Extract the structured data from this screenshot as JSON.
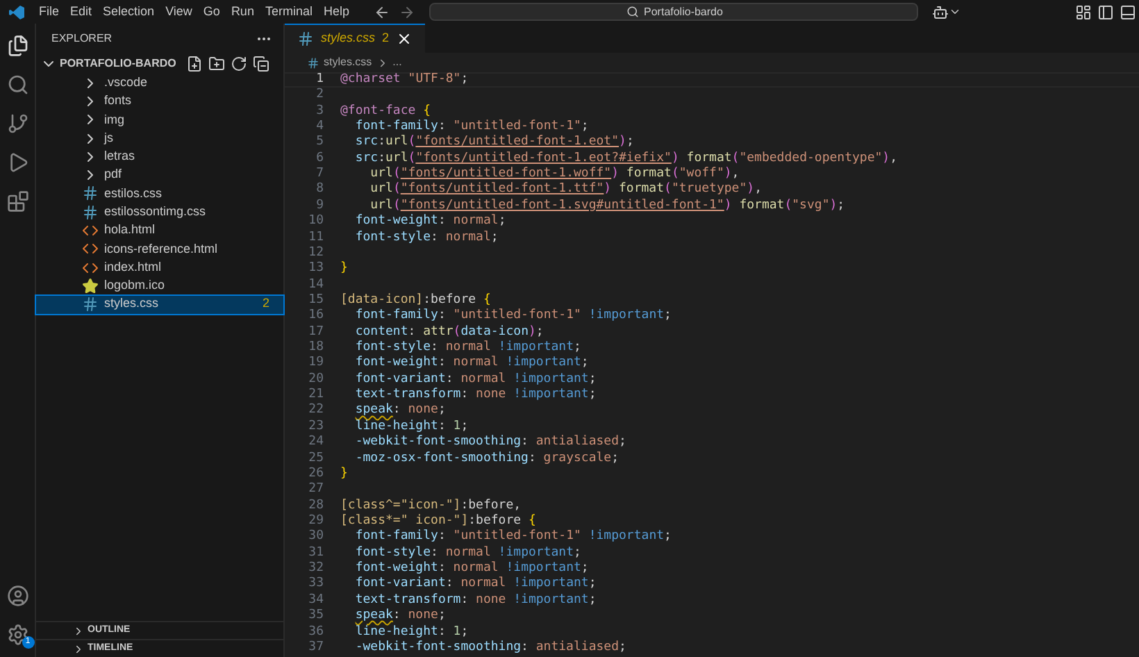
{
  "menu": [
    "File",
    "Edit",
    "Selection",
    "View",
    "Go",
    "Run",
    "Terminal",
    "Help"
  ],
  "command_center": {
    "text": "Portafolio-bardo"
  },
  "sidebar": {
    "title": "EXPLORER",
    "folder": "PORTAFOLIO-BARDO",
    "expanded": true,
    "items": [
      {
        "kind": "folder",
        "name": ".vscode",
        "selected": false
      },
      {
        "kind": "folder",
        "name": "fonts",
        "selected": false
      },
      {
        "kind": "folder",
        "name": "img",
        "selected": false
      },
      {
        "kind": "folder",
        "name": "js",
        "selected": false
      },
      {
        "kind": "folder",
        "name": "letras",
        "selected": false
      },
      {
        "kind": "folder",
        "name": "pdf",
        "selected": false
      },
      {
        "kind": "css",
        "name": "estilos.css",
        "selected": false
      },
      {
        "kind": "css",
        "name": "estilossontimg.css",
        "selected": false
      },
      {
        "kind": "html",
        "name": "hola.html",
        "selected": false
      },
      {
        "kind": "html",
        "name": "icons-reference.html",
        "selected": false
      },
      {
        "kind": "html",
        "name": "index.html",
        "selected": false
      },
      {
        "kind": "ico",
        "name": "logobm.ico",
        "selected": false
      },
      {
        "kind": "css",
        "name": "styles.css",
        "selected": true,
        "badge": "2"
      }
    ],
    "sections": [
      "OUTLINE",
      "TIMELINE"
    ]
  },
  "settings_badge": "1",
  "tab": {
    "name": "styles.css",
    "problems": "2",
    "selected": true
  },
  "breadcrumb": [
    "styles.css",
    "..."
  ],
  "editor": {
    "lines": [
      {
        "number": "1",
        "current": true,
        "tokens": [
          {
            "kind": "at",
            "text": "@charset"
          },
          {
            "kind": "str",
            "text": " \"UTF-8\""
          },
          {
            "kind": "plain",
            "text": ";"
          }
        ]
      },
      {
        "number": "2",
        "current": false
      },
      {
        "number": "3",
        "current": false,
        "tokens": [
          {
            "kind": "at",
            "text": "@font-face"
          },
          {
            "kind": "brace",
            "text": " {"
          }
        ]
      },
      {
        "number": "4",
        "current": false,
        "tokens": [
          {
            "kind": "prop",
            "text": "  font-family"
          },
          {
            "kind": "plain",
            "text": ":"
          },
          {
            "kind": "str",
            "text": " \"untitled-font-1\""
          },
          {
            "kind": "plain",
            "text": ";"
          }
        ]
      },
      {
        "number": "5",
        "current": false,
        "tokens": [
          {
            "kind": "prop",
            "text": "  src"
          },
          {
            "kind": "plain",
            "text": ":"
          },
          {
            "kind": "fn",
            "text": "url"
          },
          {
            "kind": "paren",
            "text": "("
          },
          {
            "kind": "link",
            "text": "\"fonts/untitled-font-1.eot\""
          },
          {
            "kind": "paren",
            "text": ")"
          },
          {
            "kind": "plain",
            "text": ";"
          }
        ]
      },
      {
        "number": "6",
        "current": false,
        "tokens": [
          {
            "kind": "prop",
            "text": "  src"
          },
          {
            "kind": "plain",
            "text": ":"
          },
          {
            "kind": "fn",
            "text": "url"
          },
          {
            "kind": "paren",
            "text": "("
          },
          {
            "kind": "link",
            "text": "\"fonts/untitled-font-1.eot?#iefix\""
          },
          {
            "kind": "paren",
            "text": ")"
          },
          {
            "kind": "fn",
            "text": " format"
          },
          {
            "kind": "paren",
            "text": "("
          },
          {
            "kind": "str",
            "text": "\"embedded-opentype\""
          },
          {
            "kind": "paren",
            "text": ")"
          },
          {
            "kind": "plain",
            "text": ","
          }
        ]
      },
      {
        "number": "7",
        "current": false,
        "tokens": [
          {
            "kind": "fn",
            "text": "    url"
          },
          {
            "kind": "paren",
            "text": "("
          },
          {
            "kind": "link",
            "text": "\"fonts/untitled-font-1.woff\""
          },
          {
            "kind": "paren",
            "text": ")"
          },
          {
            "kind": "fn",
            "text": " format"
          },
          {
            "kind": "paren",
            "text": "("
          },
          {
            "kind": "str",
            "text": "\"woff\""
          },
          {
            "kind": "paren",
            "text": ")"
          },
          {
            "kind": "plain",
            "text": ","
          }
        ]
      },
      {
        "number": "8",
        "current": false,
        "tokens": [
          {
            "kind": "fn",
            "text": "    url"
          },
          {
            "kind": "paren",
            "text": "("
          },
          {
            "kind": "link",
            "text": "\"fonts/untitled-font-1.ttf\""
          },
          {
            "kind": "paren",
            "text": ")"
          },
          {
            "kind": "fn",
            "text": " format"
          },
          {
            "kind": "paren",
            "text": "("
          },
          {
            "kind": "str",
            "text": "\"truetype\""
          },
          {
            "kind": "paren",
            "text": ")"
          },
          {
            "kind": "plain",
            "text": ","
          }
        ]
      },
      {
        "number": "9",
        "current": false,
        "tokens": [
          {
            "kind": "fn",
            "text": "    url"
          },
          {
            "kind": "paren",
            "text": "("
          },
          {
            "kind": "link",
            "text": "\"fonts/untitled-font-1.svg#untitled-font-1\""
          },
          {
            "kind": "paren",
            "text": ")"
          },
          {
            "kind": "fn",
            "text": " format"
          },
          {
            "kind": "paren",
            "text": "("
          },
          {
            "kind": "str",
            "text": "\"svg\""
          },
          {
            "kind": "paren",
            "text": ")"
          },
          {
            "kind": "plain",
            "text": ";"
          }
        ]
      },
      {
        "number": "10",
        "current": false,
        "tokens": [
          {
            "kind": "prop",
            "text": "  font-weight"
          },
          {
            "kind": "plain",
            "text": ":"
          },
          {
            "kind": "str",
            "text": " normal"
          },
          {
            "kind": "plain",
            "text": ";"
          }
        ]
      },
      {
        "number": "11",
        "current": false,
        "tokens": [
          {
            "kind": "prop",
            "text": "  font-style"
          },
          {
            "kind": "plain",
            "text": ":"
          },
          {
            "kind": "str",
            "text": " normal"
          },
          {
            "kind": "plain",
            "text": ";"
          }
        ]
      },
      {
        "number": "12",
        "current": false
      },
      {
        "number": "13",
        "current": false,
        "tokens": [
          {
            "kind": "brace",
            "text": "}"
          }
        ]
      },
      {
        "number": "14",
        "current": false
      },
      {
        "number": "15",
        "current": false,
        "tokens": [
          {
            "kind": "sel",
            "text": "[data-icon]"
          },
          {
            "kind": "plain",
            "text": ":before"
          },
          {
            "kind": "brace",
            "text": " {"
          }
        ]
      },
      {
        "number": "16",
        "current": false,
        "tokens": [
          {
            "kind": "prop",
            "text": "  font-family"
          },
          {
            "kind": "plain",
            "text": ":"
          },
          {
            "kind": "str",
            "text": " \"untitled-font-1\""
          },
          {
            "kind": "imp",
            "text": " !important"
          },
          {
            "kind": "plain",
            "text": ";"
          }
        ]
      },
      {
        "number": "17",
        "current": false,
        "tokens": [
          {
            "kind": "prop",
            "text": "  content"
          },
          {
            "kind": "plain",
            "text": ":"
          },
          {
            "kind": "fn",
            "text": " attr"
          },
          {
            "kind": "paren",
            "text": "("
          },
          {
            "kind": "prop",
            "text": "data-icon"
          },
          {
            "kind": "paren",
            "text": ")"
          },
          {
            "kind": "plain",
            "text": ";"
          }
        ]
      },
      {
        "number": "18",
        "current": false,
        "tokens": [
          {
            "kind": "prop",
            "text": "  font-style"
          },
          {
            "kind": "plain",
            "text": ":"
          },
          {
            "kind": "str",
            "text": " normal"
          },
          {
            "kind": "imp",
            "text": " !important"
          },
          {
            "kind": "plain",
            "text": ";"
          }
        ]
      },
      {
        "number": "19",
        "current": false,
        "tokens": [
          {
            "kind": "prop",
            "text": "  font-weight"
          },
          {
            "kind": "plain",
            "text": ":"
          },
          {
            "kind": "str",
            "text": " normal"
          },
          {
            "kind": "imp",
            "text": " !important"
          },
          {
            "kind": "plain",
            "text": ";"
          }
        ]
      },
      {
        "number": "20",
        "current": false,
        "tokens": [
          {
            "kind": "prop",
            "text": "  font-variant"
          },
          {
            "kind": "plain",
            "text": ":"
          },
          {
            "kind": "str",
            "text": " normal"
          },
          {
            "kind": "imp",
            "text": " !important"
          },
          {
            "kind": "plain",
            "text": ";"
          }
        ]
      },
      {
        "number": "21",
        "current": false,
        "tokens": [
          {
            "kind": "prop",
            "text": "  text-transform"
          },
          {
            "kind": "plain",
            "text": ":"
          },
          {
            "kind": "str",
            "text": " none"
          },
          {
            "kind": "imp",
            "text": " !important"
          },
          {
            "kind": "plain",
            "text": ";"
          }
        ]
      },
      {
        "number": "22",
        "current": false,
        "tokens": [
          {
            "kind": "warn",
            "text": "speak"
          },
          {
            "kind": "plain",
            "text": ":"
          },
          {
            "kind": "str",
            "text": " none"
          },
          {
            "kind": "plain",
            "text": ";"
          }
        ]
      },
      {
        "number": "23",
        "current": false,
        "tokens": [
          {
            "kind": "prop",
            "text": "  line-height"
          },
          {
            "kind": "plain",
            "text": ":"
          },
          {
            "kind": "num",
            "text": " 1"
          },
          {
            "kind": "plain",
            "text": ";"
          }
        ]
      },
      {
        "number": "24",
        "current": false,
        "tokens": [
          {
            "kind": "prop",
            "text": "  -webkit-font-smoothing"
          },
          {
            "kind": "plain",
            "text": ":"
          },
          {
            "kind": "str",
            "text": " antialiased"
          },
          {
            "kind": "plain",
            "text": ";"
          }
        ]
      },
      {
        "number": "25",
        "current": false,
        "tokens": [
          {
            "kind": "prop",
            "text": "  -moz-osx-font-smoothing"
          },
          {
            "kind": "plain",
            "text": ":"
          },
          {
            "kind": "str",
            "text": " grayscale"
          },
          {
            "kind": "plain",
            "text": ";"
          }
        ]
      },
      {
        "number": "26",
        "current": false,
        "tokens": [
          {
            "kind": "brace",
            "text": "}"
          }
        ]
      },
      {
        "number": "27",
        "current": false
      },
      {
        "number": "28",
        "current": false,
        "tokens": [
          {
            "kind": "sel",
            "text": "[class^=\"icon-\"]"
          },
          {
            "kind": "plain",
            "text": ":before,"
          }
        ]
      },
      {
        "number": "29",
        "current": false,
        "tokens": [
          {
            "kind": "sel",
            "text": "[class*=\" icon-\"]"
          },
          {
            "kind": "plain",
            "text": ":before"
          },
          {
            "kind": "brace",
            "text": " {"
          }
        ]
      },
      {
        "number": "30",
        "current": false,
        "tokens": [
          {
            "kind": "prop",
            "text": "  font-family"
          },
          {
            "kind": "plain",
            "text": ":"
          },
          {
            "kind": "str",
            "text": " \"untitled-font-1\""
          },
          {
            "kind": "imp",
            "text": " !important"
          },
          {
            "kind": "plain",
            "text": ";"
          }
        ]
      },
      {
        "number": "31",
        "current": false,
        "tokens": [
          {
            "kind": "prop",
            "text": "  font-style"
          },
          {
            "kind": "plain",
            "text": ":"
          },
          {
            "kind": "str",
            "text": " normal"
          },
          {
            "kind": "imp",
            "text": " !important"
          },
          {
            "kind": "plain",
            "text": ";"
          }
        ]
      },
      {
        "number": "32",
        "current": false,
        "tokens": [
          {
            "kind": "prop",
            "text": "  font-weight"
          },
          {
            "kind": "plain",
            "text": ":"
          },
          {
            "kind": "str",
            "text": " normal"
          },
          {
            "kind": "imp",
            "text": " !important"
          },
          {
            "kind": "plain",
            "text": ";"
          }
        ]
      },
      {
        "number": "33",
        "current": false,
        "tokens": [
          {
            "kind": "prop",
            "text": "  font-variant"
          },
          {
            "kind": "plain",
            "text": ":"
          },
          {
            "kind": "str",
            "text": " normal"
          },
          {
            "kind": "imp",
            "text": " !important"
          },
          {
            "kind": "plain",
            "text": ";"
          }
        ]
      },
      {
        "number": "34",
        "current": false,
        "tokens": [
          {
            "kind": "prop",
            "text": "  text-transform"
          },
          {
            "kind": "plain",
            "text": ":"
          },
          {
            "kind": "str",
            "text": " none"
          },
          {
            "kind": "imp",
            "text": " !important"
          },
          {
            "kind": "plain",
            "text": ";"
          }
        ]
      },
      {
        "number": "35",
        "current": false,
        "tokens": [
          {
            "kind": "warn",
            "text": "speak"
          },
          {
            "kind": "plain",
            "text": ":"
          },
          {
            "kind": "str",
            "text": " none"
          },
          {
            "kind": "plain",
            "text": ";"
          }
        ]
      },
      {
        "number": "36",
        "current": false,
        "tokens": [
          {
            "kind": "prop",
            "text": "  line-height"
          },
          {
            "kind": "plain",
            "text": ":"
          },
          {
            "kind": "num",
            "text": " 1"
          },
          {
            "kind": "plain",
            "text": ";"
          }
        ]
      },
      {
        "number": "37",
        "current": false,
        "tokens": [
          {
            "kind": "prop",
            "text": "  -webkit-font-smoothing"
          },
          {
            "kind": "plain",
            "text": ":"
          },
          {
            "kind": "str",
            "text": " antialiased"
          },
          {
            "kind": "plain",
            "text": ";"
          }
        ]
      }
    ]
  }
}
